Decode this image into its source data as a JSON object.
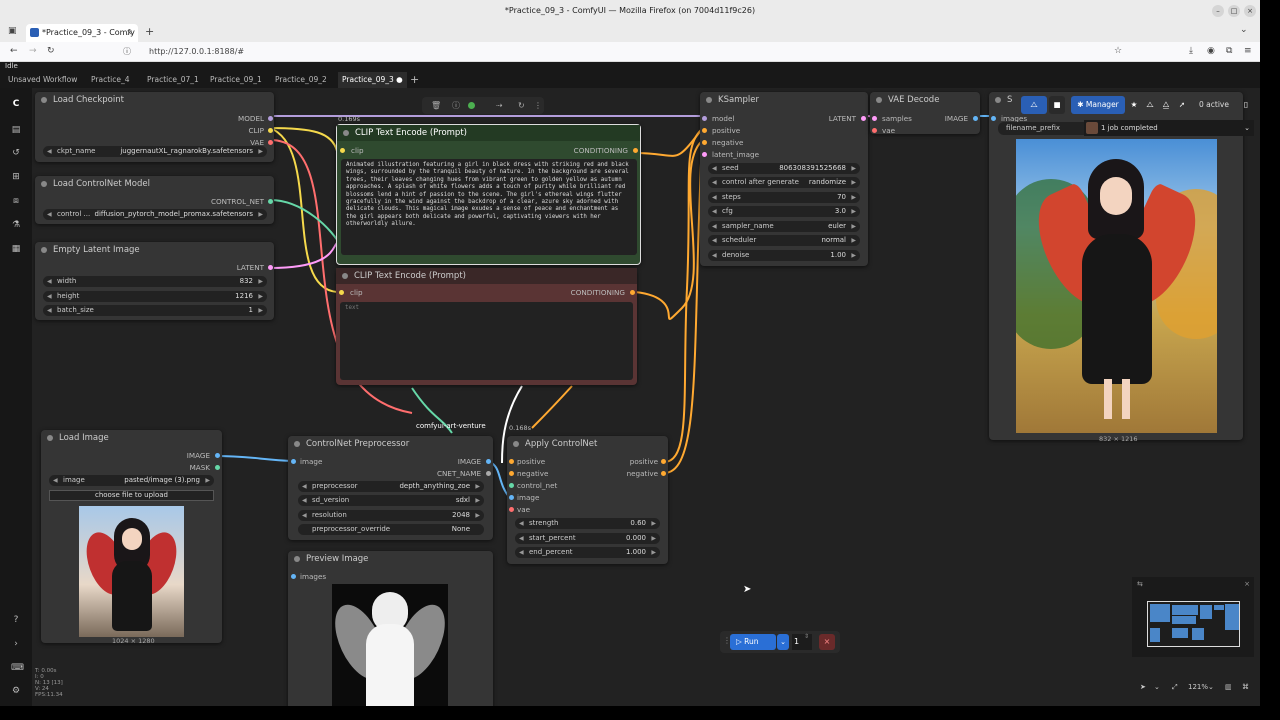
{
  "browser": {
    "window_title": "*Practice_09_3 - ComfyUI — Mozilla Firefox (on 7004d11f9c26)",
    "tab_title": "*Practice_09_3 - Comfy",
    "url": "http://127.0.0.1:8188/#",
    "new_tab": "+",
    "status": "Idle"
  },
  "workflow_tabs": [
    {
      "label": "Unsaved Workflow"
    },
    {
      "label": "Practice_4"
    },
    {
      "label": "Practice_07_1"
    },
    {
      "label": "Practice_09_1"
    },
    {
      "label": "Practice_09_2"
    },
    {
      "label": "Practice_09_3"
    }
  ],
  "add_tab": "+",
  "toolbar": {
    "manager": "Manager",
    "active": "0 active",
    "job": "1 job completed",
    "filename_prefix": "filename_prefix"
  },
  "nodes": {
    "load_checkpoint": {
      "title": "Load Checkpoint",
      "out": [
        "MODEL",
        "CLIP",
        "VAE"
      ],
      "ckpt_label": "ckpt_name",
      "ckpt_value": "juggernautXL_ragnarokBy.safetensors"
    },
    "load_controlnet": {
      "title": "Load ControlNet Model",
      "out": "CONTROL_NET",
      "label": "control ...",
      "value": "diffusion_pytorch_model_promax.safetensors"
    },
    "empty_latent": {
      "title": "Empty Latent Image",
      "out": "LATENT",
      "width_label": "width",
      "width": "832",
      "height_label": "height",
      "height": "1216",
      "batch_label": "batch_size",
      "batch": "1"
    },
    "clip_pos": {
      "title": "CLIP Text Encode (Prompt)",
      "timing": "0.169s",
      "in": "clip",
      "out": "CONDITIONING",
      "text": "Animated illustration featuring a girl in black dress with striking red and black wings, surrounded by the tranquil beauty of nature. In the background are several trees, their leaves changing hues from vibrant green to golden yellow as autumn approaches. A splash of white flowers adds a touch of purity while brilliant red blossoms lend a hint of passion to the scene. The girl's ethereal wings flutter gracefully in the wind against the backdrop of a clear, azure sky adorned with delicate clouds. This magical image exudes a sense of peace and enchantment as the girl appears both delicate and powerful, captivating viewers with her otherworldly allure."
    },
    "clip_neg": {
      "title": "CLIP Text Encode (Prompt)",
      "in": "clip",
      "out": "CONDITIONING",
      "placeholder": "text"
    },
    "ksampler": {
      "title": "KSampler",
      "in": [
        "model",
        "positive",
        "negative",
        "latent_image"
      ],
      "out": "LATENT",
      "widgets": [
        {
          "label": "seed",
          "value": "806308391525668"
        },
        {
          "label": "control after generate",
          "value": "randomize"
        },
        {
          "label": "steps",
          "value": "70"
        },
        {
          "label": "cfg",
          "value": "3.0"
        },
        {
          "label": "sampler_name",
          "value": "euler"
        },
        {
          "label": "scheduler",
          "value": "normal"
        },
        {
          "label": "denoise",
          "value": "1.00"
        }
      ]
    },
    "vae_decode": {
      "title": "VAE Decode",
      "in": [
        "samples",
        "vae"
      ],
      "out": "IMAGE"
    },
    "save_image": {
      "title": "S",
      "in": "images",
      "size": "832 × 1216"
    },
    "load_image": {
      "title": "Load Image",
      "out": [
        "IMAGE",
        "MASK"
      ],
      "image_label": "image",
      "image_value": "pasted/image (3).png",
      "upload": "choose file to upload",
      "size": "1024 × 1280"
    },
    "cn_pre": {
      "title": "ControlNet Preprocessor",
      "in": "image",
      "out": [
        "IMAGE",
        "CNET_NAME"
      ],
      "widgets": [
        {
          "label": "preprocessor",
          "value": "depth_anything_zoe"
        },
        {
          "label": "sd_version",
          "value": "sdxl"
        },
        {
          "label": "resolution",
          "value": "2048"
        },
        {
          "label": "preprocessor_override",
          "value": "None"
        }
      ],
      "group": "comfyui-art-venture"
    },
    "apply_cn": {
      "title": "Apply ControlNet",
      "timing": "0.168s",
      "in": [
        "positive",
        "negative",
        "control_net",
        "image",
        "vae"
      ],
      "out": [
        "positive",
        "negative"
      ],
      "widgets": [
        {
          "label": "strength",
          "value": "0.60"
        },
        {
          "label": "start_percent",
          "value": "0.000"
        },
        {
          "label": "end_percent",
          "value": "1.000"
        }
      ]
    },
    "preview": {
      "title": "Preview Image",
      "in": "images"
    }
  },
  "run": {
    "label": "Run",
    "count": "1"
  },
  "stats": [
    "T: 0.00s",
    "I: 0",
    "N: 13 [13]",
    "V: 24",
    "FPS:11.34"
  ],
  "zoom": "121%",
  "colors": {
    "clip": "#f5d94c",
    "model": "#b39ddb",
    "vae": "#ff6e6e",
    "cond": "#ffa931",
    "latent": "#ff9cf9",
    "cnet": "#66d8a8",
    "image": "#64b5f6",
    "green_node": "#2f4a2f",
    "red_node": "#5a3434"
  }
}
